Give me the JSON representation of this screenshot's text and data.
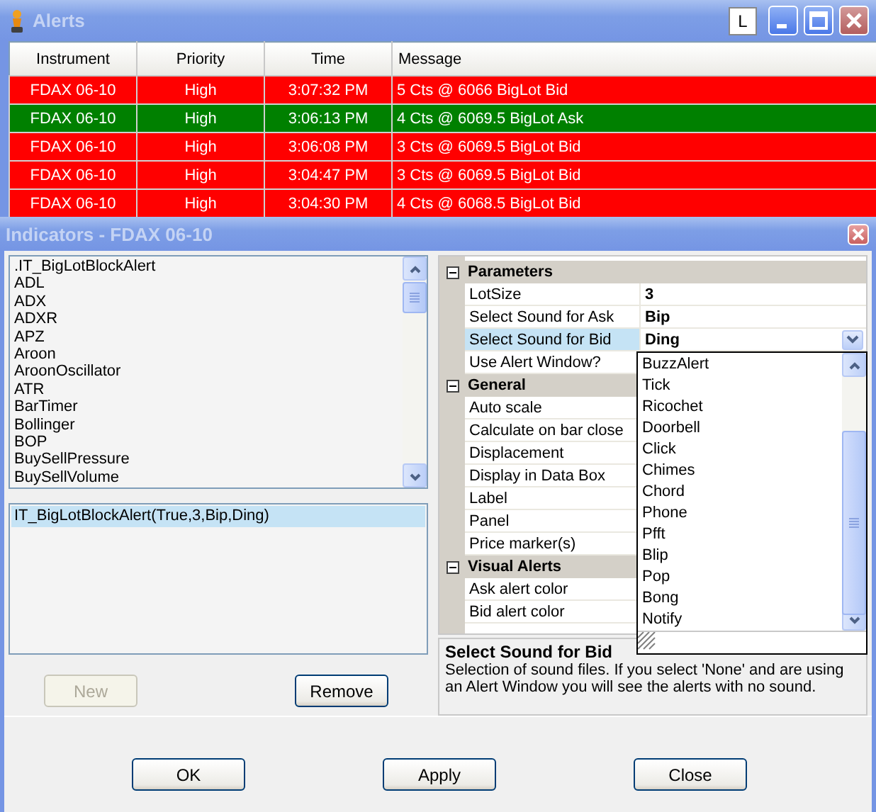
{
  "alerts_window": {
    "title": "Alerts",
    "toolbar_button": "L",
    "columns": [
      "Instrument",
      "Priority",
      "Time",
      "Message"
    ],
    "rows": [
      {
        "instrument": "FDAX 06-10",
        "priority": "High",
        "time": "3:07:32 PM",
        "message": "5 Cts @ 6066 BigLot Bid",
        "color": "#ff0000"
      },
      {
        "instrument": "FDAX 06-10",
        "priority": "High",
        "time": "3:06:13 PM",
        "message": "4 Cts @ 6069.5 BigLot Ask",
        "color": "#008000"
      },
      {
        "instrument": "FDAX 06-10",
        "priority": "High",
        "time": "3:06:08 PM",
        "message": "3 Cts @ 6069.5 BigLot Bid",
        "color": "#ff0000"
      },
      {
        "instrument": "FDAX 06-10",
        "priority": "High",
        "time": "3:04:47 PM",
        "message": "3 Cts @ 6069.5 BigLot Bid",
        "color": "#ff0000"
      },
      {
        "instrument": "FDAX 06-10",
        "priority": "High",
        "time": "3:04:30 PM",
        "message": "4 Cts @ 6068.5 BigLot Bid",
        "color": "#ff0000"
      }
    ]
  },
  "indicators_window": {
    "title": "Indicators - FDAX 06-10",
    "available_indicators": [
      ".IT_BigLotBlockAlert",
      "ADL",
      "ADX",
      "ADXR",
      "APZ",
      "Aroon",
      "AroonOscillator",
      "ATR",
      "BarTimer",
      "Bollinger",
      "BOP",
      "BuySellPressure",
      "BuySellVolume"
    ],
    "applied_indicators": [
      {
        "label": "IT_BigLotBlockAlert(True,3,Bip,Ding)",
        "selected": true
      }
    ],
    "list_buttons": [
      {
        "label": "New",
        "disabled": true
      },
      {
        "label": "Remove",
        "disabled": false
      }
    ],
    "properties": [
      {
        "category": "Parameters",
        "expanded": true,
        "items": [
          {
            "name": "LotSize",
            "value": "3",
            "selected": false
          },
          {
            "name": "Select Sound for Ask",
            "value": "Bip",
            "selected": false
          },
          {
            "name": "Select Sound for Bid",
            "value": "Ding",
            "selected": true
          },
          {
            "name": "Use Alert Window?",
            "selected": false
          }
        ]
      },
      {
        "category": "General",
        "expanded": true,
        "items": [
          {
            "name": "Auto scale",
            "selected": false
          },
          {
            "name": "Calculate on bar close",
            "selected": false
          },
          {
            "name": "Displacement",
            "selected": false
          },
          {
            "name": "Display in Data Box",
            "selected": false
          },
          {
            "name": "Label",
            "selected": false
          },
          {
            "name": "Panel",
            "selected": false
          },
          {
            "name": "Price marker(s)",
            "selected": false
          }
        ]
      },
      {
        "category": "Visual Alerts",
        "expanded": true,
        "items": [
          {
            "name": "Ask alert color",
            "selected": false
          },
          {
            "name": "Bid alert color",
            "selected": false
          }
        ]
      }
    ],
    "dropdown": {
      "open": true,
      "options": [
        "BuzzAlert",
        "Tick",
        "Ricochet",
        "Doorbell",
        "Click",
        "Chimes",
        "Chord",
        "Phone",
        "Pfft",
        "Blip",
        "Pop",
        "Bong",
        "Notify"
      ]
    },
    "description": {
      "title": "Select Sound for Bid",
      "text": "Selection of sound files. If you select 'None' and are using an Alert Window you will see the alerts with no sound."
    },
    "dialog_buttons": [
      "OK",
      "Apply",
      "Close"
    ]
  }
}
